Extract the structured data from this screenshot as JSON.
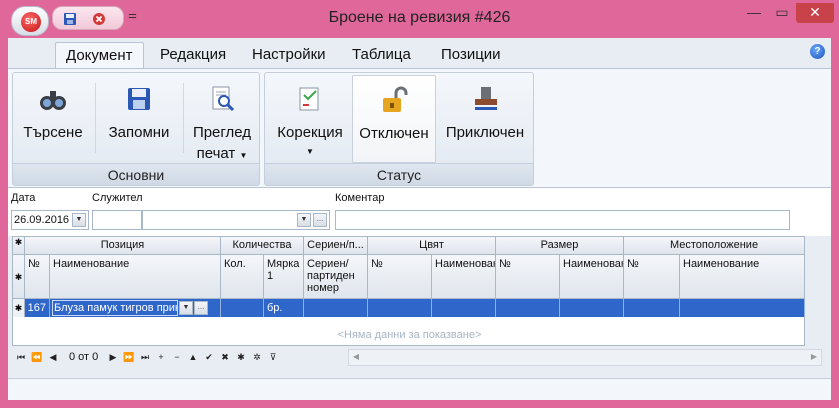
{
  "window": {
    "title": "Броене на ревизия #426",
    "minimize": "—",
    "maximize": "▭",
    "close": "✕"
  },
  "app_button": {
    "logo_text": "SM"
  },
  "quick_access": [
    {
      "icon": "save-icon"
    },
    {
      "icon": "cancel-icon"
    },
    {
      "icon": "customize-dropdown-icon",
      "label": "⚌"
    }
  ],
  "tabs": [
    {
      "label": "Документ",
      "active": true
    },
    {
      "label": "Редакция"
    },
    {
      "label": "Настройки"
    },
    {
      "label": "Таблица"
    },
    {
      "label": "Позиции"
    }
  ],
  "help_label": "?",
  "ribbon": {
    "groups": [
      {
        "label": "Основни",
        "buttons": [
          {
            "label": "Търсене",
            "icon": "binoculars-icon"
          },
          {
            "label": "Запомни",
            "icon": "floppy-disk-icon"
          },
          {
            "label": "Преглед",
            "label2": "печат",
            "icon": "print-preview-icon",
            "has_dropdown": true
          }
        ]
      },
      {
        "label": "Статус",
        "buttons": [
          {
            "label": "Корекция",
            "icon": "correction-icon",
            "has_dropdown": true
          },
          {
            "label": "Отключен",
            "icon": "unlocked-padlock-icon",
            "active": true
          },
          {
            "label": "Приключен",
            "icon": "stamp-icon"
          }
        ]
      }
    ]
  },
  "form": {
    "date_label": "Дата",
    "date_value": "26.09.2016",
    "employee_label": "Служител",
    "employee_code": "",
    "employee_name": "",
    "comment_label": "Коментар",
    "comment_value": "",
    "ellipsis": "…"
  },
  "grid": {
    "groups": [
      "Позиция",
      "Количества",
      "Сериен/п...",
      "Цвят",
      "Размер",
      "Местоположение"
    ],
    "columns": {
      "no": "№",
      "name": "Наименование",
      "qty": "Кол.",
      "unit": "Мярка 1",
      "serial": "Сериен/партиден номер",
      "color_no": "№",
      "color_name": "Наименование",
      "size_no": "№",
      "size_name": "Наименование",
      "loc_no": "№",
      "loc_name": "Наименование"
    },
    "row": {
      "no": "167",
      "name": "Блуза памук тигров принт",
      "qty": "",
      "unit": "бр.",
      "serial": "",
      "color_no": "",
      "color_name": "",
      "size_no": "",
      "size_name": "",
      "loc_no": "",
      "loc_name": ""
    },
    "empty_text": "<Няма данни за показване>"
  },
  "navigator": {
    "position_text": "0 от 0"
  },
  "colors": {
    "window_frame": "#e0679a",
    "selection": "#2f66c9",
    "ribbon": "#f3f6fa"
  }
}
